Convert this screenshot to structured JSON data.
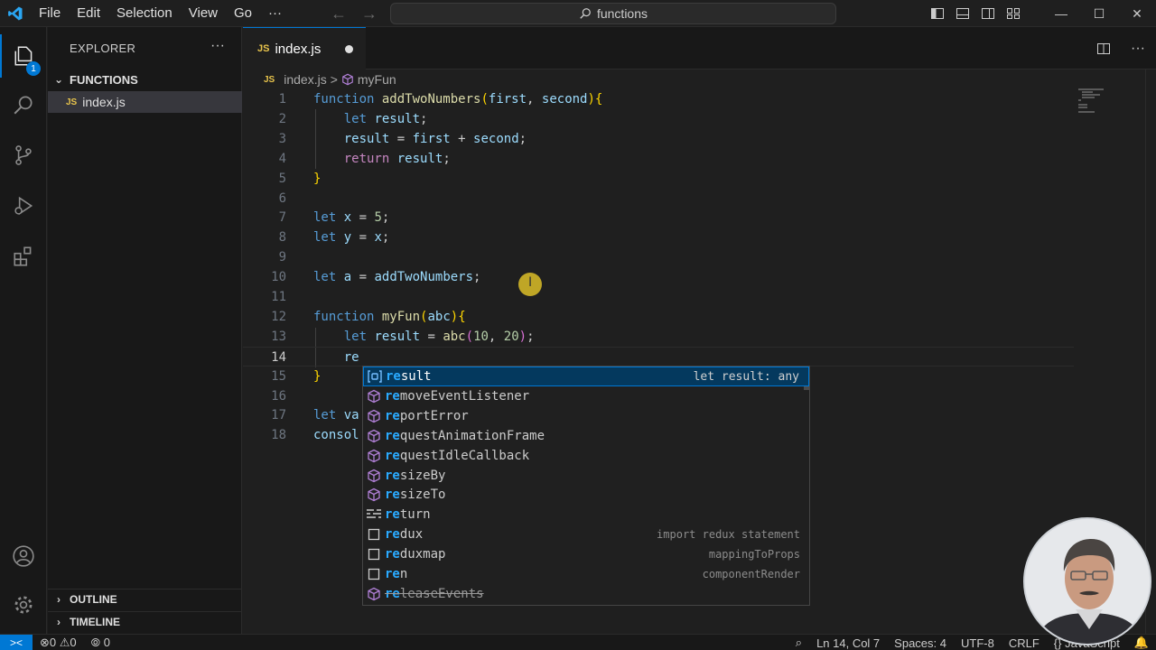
{
  "titlebar": {
    "menus": [
      "File",
      "Edit",
      "Selection",
      "View",
      "Go",
      "···"
    ],
    "search": "functions"
  },
  "activity": {
    "explorer_badge": "1"
  },
  "sidebar": {
    "title": "EXPLORER",
    "more": "···",
    "folder": "FUNCTIONS",
    "file": "index.js",
    "file_icon": "JS",
    "outline": "OUTLINE",
    "timeline": "TIMELINE"
  },
  "tab": {
    "icon": "JS",
    "name": "index.js"
  },
  "breadcrumb": {
    "file": "index.js",
    "sep": ">",
    "symbol": "myFun"
  },
  "editor": {
    "lines": [
      [
        [
          "kw",
          "function"
        ],
        [
          "d",
          " "
        ],
        [
          "fn",
          "addTwoNumbers"
        ],
        [
          "br1",
          "("
        ],
        [
          "vr",
          "first"
        ],
        [
          "d",
          ", "
        ],
        [
          "vr",
          "second"
        ],
        [
          "br1",
          ")"
        ],
        [
          "br1",
          "{"
        ]
      ],
      [
        [
          "d",
          "    "
        ],
        [
          "kw",
          "let"
        ],
        [
          "d",
          " "
        ],
        [
          "vr",
          "result"
        ],
        [
          "d",
          ";"
        ]
      ],
      [
        [
          "d",
          "    "
        ],
        [
          "vr",
          "result"
        ],
        [
          "d",
          " = "
        ],
        [
          "vr",
          "first"
        ],
        [
          "d",
          " + "
        ],
        [
          "vr",
          "second"
        ],
        [
          "d",
          ";"
        ]
      ],
      [
        [
          "d",
          "    "
        ],
        [
          "ctl",
          "return"
        ],
        [
          "d",
          " "
        ],
        [
          "vr",
          "result"
        ],
        [
          "d",
          ";"
        ]
      ],
      [
        [
          "br1",
          "}"
        ]
      ],
      [],
      [
        [
          "kw",
          "let"
        ],
        [
          "d",
          " "
        ],
        [
          "vr",
          "x"
        ],
        [
          "d",
          " = "
        ],
        [
          "num",
          "5"
        ],
        [
          "d",
          ";"
        ]
      ],
      [
        [
          "kw",
          "let"
        ],
        [
          "d",
          " "
        ],
        [
          "vr",
          "y"
        ],
        [
          "d",
          " = "
        ],
        [
          "vr",
          "x"
        ],
        [
          "d",
          ";"
        ]
      ],
      [],
      [
        [
          "kw",
          "let"
        ],
        [
          "d",
          " "
        ],
        [
          "vr",
          "a"
        ],
        [
          "d",
          " = "
        ],
        [
          "vr",
          "addTwoNumbers"
        ],
        [
          "d",
          ";"
        ]
      ],
      [],
      [
        [
          "kw",
          "function"
        ],
        [
          "d",
          " "
        ],
        [
          "fn",
          "myFun"
        ],
        [
          "br1",
          "("
        ],
        [
          "vr",
          "abc"
        ],
        [
          "br1",
          ")"
        ],
        [
          "br1",
          "{"
        ]
      ],
      [
        [
          "d",
          "    "
        ],
        [
          "kw",
          "let"
        ],
        [
          "d",
          " "
        ],
        [
          "vr",
          "result"
        ],
        [
          "d",
          " = "
        ],
        [
          "fn",
          "abc"
        ],
        [
          "br2",
          "("
        ],
        [
          "num",
          "10"
        ],
        [
          "d",
          ", "
        ],
        [
          "num",
          "20"
        ],
        [
          "br2",
          ")"
        ],
        [
          "d",
          ";"
        ]
      ],
      [
        [
          "d",
          "    "
        ],
        [
          "vr",
          "re"
        ]
      ],
      [
        [
          "br1",
          "}"
        ]
      ],
      [],
      [
        [
          "kw",
          "let"
        ],
        [
          "d",
          " "
        ],
        [
          "vr",
          "va"
        ]
      ],
      [
        [
          "vr",
          "consol"
        ]
      ]
    ],
    "current_line": 14
  },
  "suggest": {
    "items": [
      {
        "match": "re",
        "rest": "sult",
        "kind": "variable",
        "detail": "let result: any",
        "selected": true
      },
      {
        "match": "re",
        "rest": "moveEventListener",
        "kind": "method",
        "detail": ""
      },
      {
        "match": "re",
        "rest": "portError",
        "kind": "method",
        "detail": ""
      },
      {
        "match": "re",
        "rest": "questAnimationFrame",
        "kind": "method",
        "detail": ""
      },
      {
        "match": "re",
        "rest": "questIdleCallback",
        "kind": "method",
        "detail": ""
      },
      {
        "match": "re",
        "rest": "sizeBy",
        "kind": "method",
        "detail": ""
      },
      {
        "match": "re",
        "rest": "sizeTo",
        "kind": "method",
        "detail": ""
      },
      {
        "match": "re",
        "rest": "turn",
        "kind": "keyword",
        "detail": ""
      },
      {
        "match": "re",
        "rest": "dux",
        "kind": "snippet",
        "detail": "import redux statement"
      },
      {
        "match": "re",
        "rest": "duxmap",
        "kind": "snippet",
        "detail": "mappingToProps"
      },
      {
        "match": "re",
        "rest": "n",
        "kind": "snippet",
        "detail": "componentRender"
      },
      {
        "match": "re",
        "rest": "leaseEvents",
        "kind": "method",
        "detail": "",
        "deprecated": true
      }
    ]
  },
  "status": {
    "errors": "0",
    "warnings": "0",
    "ports": "0",
    "position": "Ln 14, Col 7",
    "spaces": "Spaces: 4",
    "encoding": "UTF-8",
    "eol": "CRLF",
    "language": "JavaScript"
  },
  "colors": {
    "accent": "#0078d4",
    "keyword": "#569cd6",
    "function": "#dcdcaa",
    "variable": "#9cdcfe",
    "number": "#b5cea8",
    "control": "#c586c0"
  }
}
